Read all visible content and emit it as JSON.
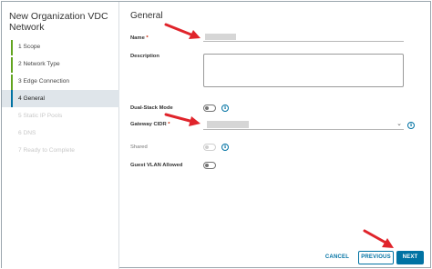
{
  "wizard": {
    "title": "New Organization VDC Network",
    "steps": [
      {
        "label": "1  Scope",
        "state": "done"
      },
      {
        "label": "2  Network Type",
        "state": "done"
      },
      {
        "label": "3  Edge Connection",
        "state": "done"
      },
      {
        "label": "4  General",
        "state": "active"
      },
      {
        "label": "5  Static IP Pools",
        "state": "disabled"
      },
      {
        "label": "6  DNS",
        "state": "disabled"
      },
      {
        "label": "7  Ready to Complete",
        "state": "disabled"
      }
    ]
  },
  "form": {
    "section_title": "General",
    "name_label": "Name",
    "required_marker": "*",
    "description_label": "Description",
    "dual_stack_label": "Dual-Stack Mode",
    "gateway_cidr_label": "Gateway CIDR",
    "shared_label": "Shared",
    "guest_vlan_label": "Guest VLAN Allowed"
  },
  "footer": {
    "cancel_label": "CANCEL",
    "previous_label": "PREVIOUS",
    "next_label": "NEXT"
  },
  "colors": {
    "accent": "#0072a3",
    "step_done": "#62a420",
    "annotation_arrow": "#e0242b"
  }
}
